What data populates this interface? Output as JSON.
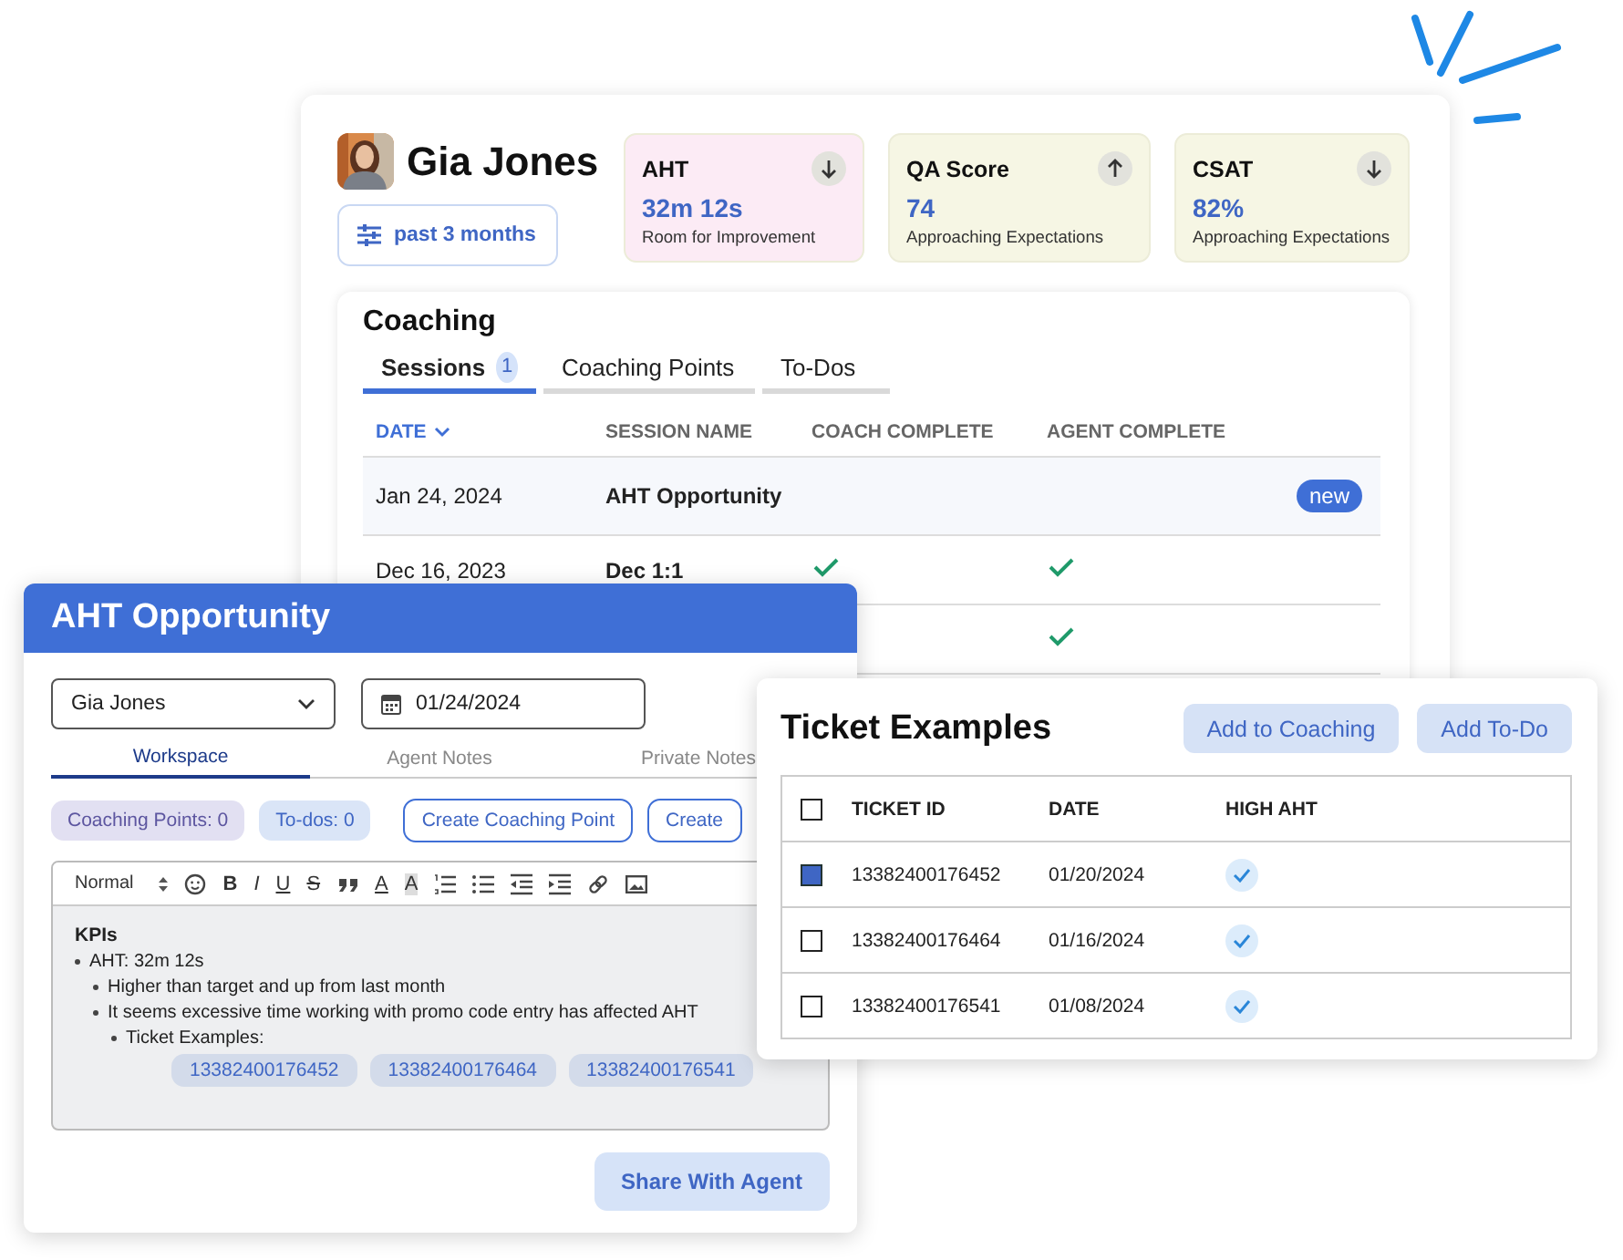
{
  "header": {
    "name": "Gia Jones",
    "filter": "past 3 months"
  },
  "metrics": [
    {
      "label": "AHT",
      "value": "32m 12s",
      "caption": "Room for Improvement",
      "trend_up": false,
      "color": "#fcebf5"
    },
    {
      "label": "QA Score",
      "value": "74",
      "caption": "Approaching Expectations",
      "trend_up": true,
      "color": "#f6f6e4"
    },
    {
      "label": "CSAT",
      "value": "82%",
      "caption": "Approaching Expectations",
      "trend_up": false,
      "color": "#f6f6e4"
    }
  ],
  "coaching": {
    "title": "Coaching",
    "tabs": [
      {
        "label": "Sessions",
        "badge": "1",
        "selected": true
      },
      {
        "label": "Coaching Points",
        "selected": false
      },
      {
        "label": "To-Dos",
        "selected": false
      }
    ],
    "columns": [
      {
        "label": "DATE",
        "sorted": true
      },
      {
        "label": "SESSION NAME",
        "sorted": false
      },
      {
        "label": "COACH COMPLETE",
        "sorted": false
      },
      {
        "label": "AGENT COMPLETE",
        "sorted": false
      }
    ],
    "rows": [
      {
        "date": "Jan 24, 2024",
        "name": "AHT Opportunity",
        "coach_complete": false,
        "agent_complete": false,
        "badge": "new",
        "selected": true
      },
      {
        "date": "Dec 16, 2023",
        "name": "Dec 1:1",
        "coach_complete": true,
        "agent_complete": true,
        "selected": false
      },
      {
        "agent_complete": true,
        "selected": false
      }
    ]
  },
  "session_window": {
    "title": "AHT Opportunity",
    "agent": "Gia Jones",
    "date": "01/24/2024",
    "tabs": [
      {
        "label": "Workspace",
        "selected": true
      },
      {
        "label": "Agent Notes",
        "selected": false
      },
      {
        "label": "Private Notes",
        "selected": false
      }
    ],
    "chips": [
      {
        "label": "Coaching Points: 0",
        "kind": "points"
      },
      {
        "label": "To-dos: 0",
        "kind": "todos"
      }
    ],
    "buttons": [
      "Create Coaching Point",
      "Create"
    ],
    "editor": {
      "format": "Normal",
      "marks": [
        {
          "kind": "bold",
          "text": "B"
        },
        {
          "kind": "italic",
          "text": "I"
        },
        {
          "kind": "underline",
          "text": "U"
        },
        {
          "kind": "strike",
          "text": "S"
        },
        {
          "kind": "color",
          "text": "A"
        },
        {
          "kind": "highlight",
          "text": "A"
        }
      ],
      "heading": "KPIs",
      "items": [
        {
          "text": "AHT: 32m 12s",
          "children": [
            {
              "text": "Higher than target and up from last month"
            },
            {
              "text": "It seems excessive time working with promo code entry has affected AHT",
              "children": [
                {
                  "text": "Ticket Examples:",
                  "chips": [
                    "13382400176452",
                    "13382400176464",
                    "13382400176541"
                  ]
                }
              ]
            }
          ]
        }
      ]
    },
    "share_button": "Share With Agent"
  },
  "ticket_window": {
    "title": "Ticket Examples",
    "buttons": [
      "Add to Coaching",
      "Add To-Do"
    ],
    "all_checked": false,
    "columns": [
      "TICKET ID",
      "DATE",
      "HIGH AHT"
    ],
    "rows": [
      {
        "id": "13382400176452",
        "date": "01/20/2024",
        "high_aht": true,
        "checked": true
      },
      {
        "id": "13382400176464",
        "date": "01/16/2024",
        "high_aht": true,
        "checked": false
      },
      {
        "id": "13382400176541",
        "date": "01/08/2024",
        "high_aht": true,
        "checked": false
      }
    ]
  }
}
